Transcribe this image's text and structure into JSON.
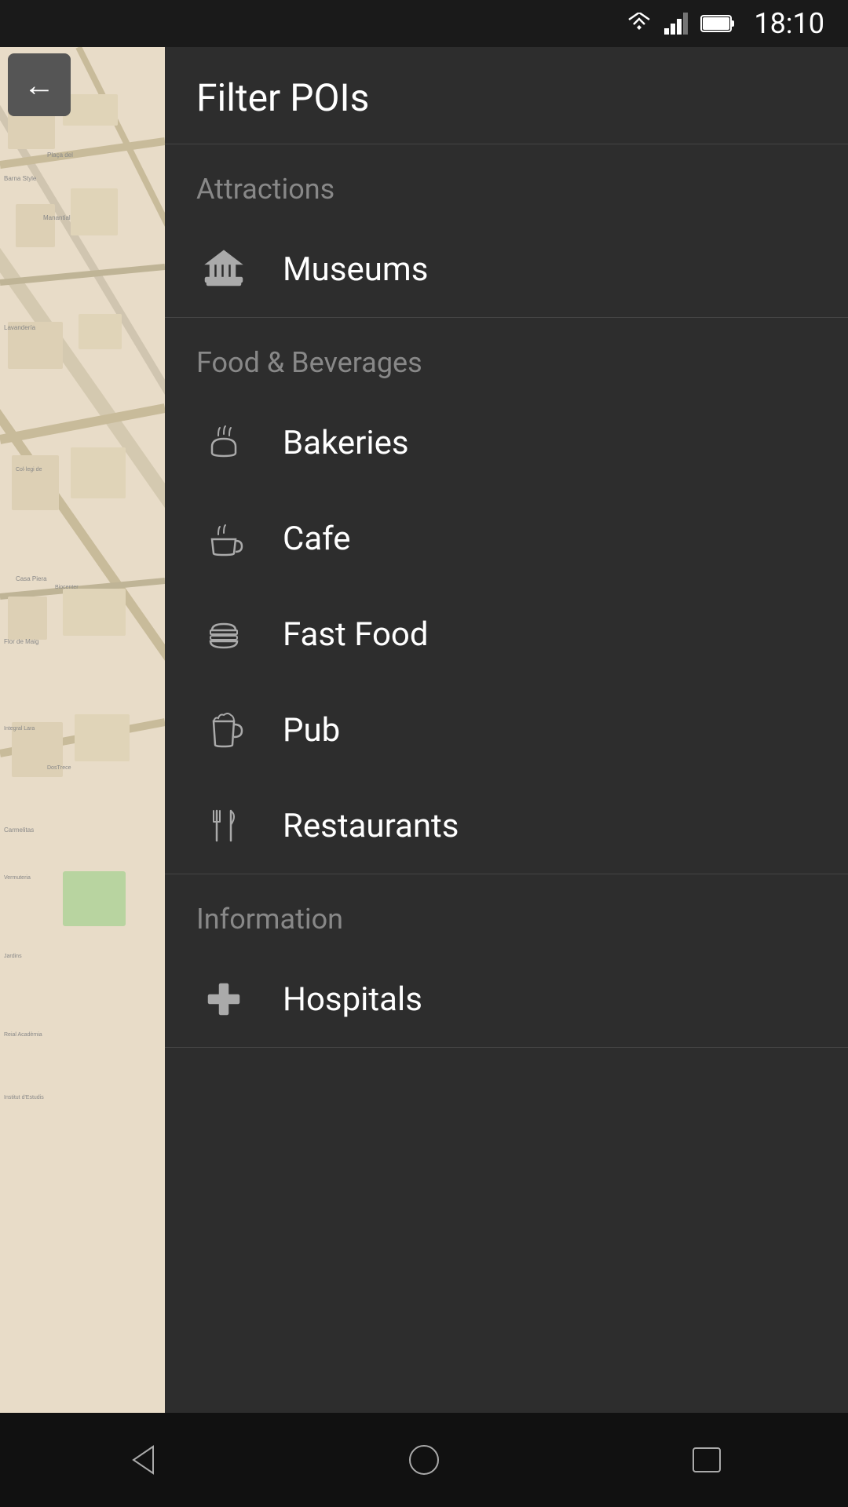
{
  "statusBar": {
    "time": "18:10"
  },
  "header": {
    "title": "Filter POIs"
  },
  "sections": [
    {
      "id": "attractions",
      "title": "Attractions",
      "items": [
        {
          "id": "museums",
          "label": "Museums",
          "icon": "museum"
        }
      ]
    },
    {
      "id": "food-beverages",
      "title": "Food & Beverages",
      "items": [
        {
          "id": "bakeries",
          "label": "Bakeries",
          "icon": "bakery"
        },
        {
          "id": "cafe",
          "label": "Cafe",
          "icon": "cafe"
        },
        {
          "id": "fast-food",
          "label": "Fast Food",
          "icon": "fastfood"
        },
        {
          "id": "pub",
          "label": "Pub",
          "icon": "pub"
        },
        {
          "id": "restaurants",
          "label": "Restaurants",
          "icon": "restaurant"
        }
      ]
    },
    {
      "id": "information",
      "title": "Information",
      "items": [
        {
          "id": "hospitals",
          "label": "Hospitals",
          "icon": "hospital"
        }
      ]
    }
  ],
  "navBar": {
    "back": "back",
    "home": "home",
    "recent": "recent"
  }
}
